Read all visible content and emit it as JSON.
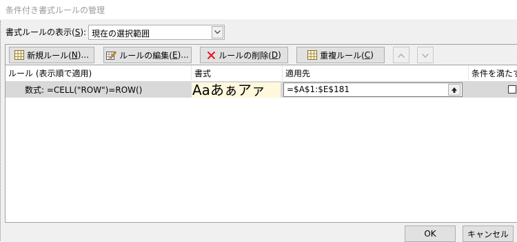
{
  "window": {
    "title": "条件付き書式ルールの管理"
  },
  "show_rules": {
    "label": "書式ルールの表示(",
    "label_key": "S",
    "label_end": "):",
    "selected": "現在の選択範囲"
  },
  "toolbar": {
    "new_rule": "新規ルール(",
    "new_rule_key": "N",
    "new_rule_end": ")...",
    "edit_rule": "ルールの編集(",
    "edit_rule_key": "E",
    "edit_rule_end": ")...",
    "delete_rule": "ルールの削除(",
    "delete_rule_key": "D",
    "delete_rule_end": ")",
    "duplicate_rule": "重複ルール(",
    "duplicate_rule_key": "C",
    "duplicate_rule_end": ")"
  },
  "table": {
    "headers": {
      "rule": "ルール (表示順で適用)",
      "format": "書式",
      "applies_to": "適用先",
      "stop_if_true": "条件を満たす"
    },
    "rows": [
      {
        "rule": "数式: =CELL(\"ROW\")=ROW()",
        "format_preview": "Aaあぁアァ",
        "applies_to": "=$A$1:$E$181",
        "stop_if_true": false
      }
    ]
  },
  "footer": {
    "ok": "OK",
    "cancel": "キャンセル"
  },
  "colors": {
    "row_selected": "#d9d9d9",
    "format_preview_bg": "#fff8dc",
    "delete_icon": "#e81123"
  }
}
